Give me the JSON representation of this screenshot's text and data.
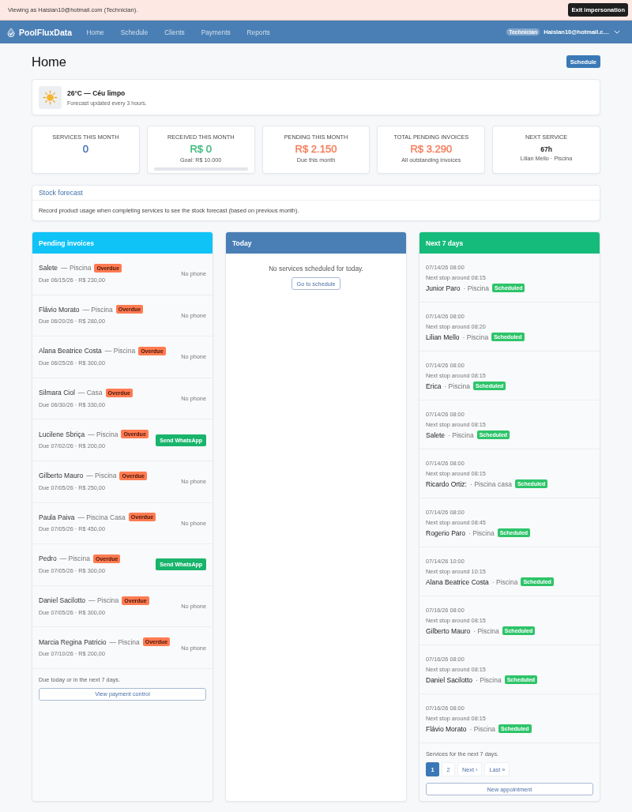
{
  "impersonation_banner": {
    "text": "Viewing as Haislan10@hotmail.com (Technician).",
    "button": "Exit impersonation"
  },
  "navbar": {
    "brand": "PoolFluxData",
    "items": [
      "Home",
      "Schedule",
      "Clients",
      "Payments",
      "Reports"
    ],
    "role_badge": "Technician",
    "user": "Haislan10@hotmail.c…"
  },
  "page": {
    "title": "Home",
    "button": "Schedule"
  },
  "weather": {
    "title": "26°C — Céu limpo",
    "note": "Forecast updated every 3 hours."
  },
  "stats": [
    {
      "kind": "count",
      "label": "SERVICES THIS MONTH",
      "value": "0",
      "color": "#3f6fb3"
    },
    {
      "kind": "progress",
      "label": "RECEIVED THIS MONTH",
      "value": "R$ 0",
      "color": "#3cb878",
      "note": "Goal: R$ 10.000",
      "level": 0
    },
    {
      "kind": "amount",
      "label": "PENDING THIS MONTH",
      "value": "R$ 2.150",
      "color": "#f47b59",
      "note": "Due this month"
    },
    {
      "kind": "amount",
      "label": "TOTAL PENDING INVOICES",
      "value": "R$ 3.290",
      "color": "#f47b59",
      "note": "All outstanding invoices"
    },
    {
      "kind": "next",
      "label": "NEXT SERVICE",
      "value": "67h",
      "color": "#222222",
      "note": "Lilian Mello · Piscina"
    }
  ],
  "stock_forecast": {
    "title": "Stock forecast",
    "text": "Record product usage when completing services to see the stock forecast (based on previous month)."
  },
  "pending_invoices": {
    "title": "Pending invoices",
    "rows": [
      {
        "name": "Salete",
        "place": "— Piscina",
        "badge": "Overdue",
        "due": "Due 06/15/26 · R$ 230,00",
        "kind": "note",
        "action": "No phone"
      },
      {
        "name": "Flávio Morato",
        "place": "— Piscina",
        "badge": "Overdue",
        "due": "Due 06/20/26 · R$ 280,00",
        "kind": "note",
        "action": "No phone"
      },
      {
        "name": "Alana Beatrice Costa",
        "place": "— Piscina",
        "badge": "Overdue",
        "due": "Due 06/25/26 · R$ 300,00",
        "kind": "note",
        "action": "No phone"
      },
      {
        "name": "Silmara Ciol",
        "place": "— Casa",
        "badge": "Overdue",
        "due": "Due 06/30/26 · R$ 330,00",
        "kind": "note",
        "action": "No phone"
      },
      {
        "name": "Lucilene Sbriça",
        "place": "— Piscina",
        "badge": "Overdue",
        "due": "Due 07/02/26 · R$ 200,00",
        "kind": "whatsapp",
        "action": "Send WhatsApp"
      },
      {
        "name": "Gilberto Mauro",
        "place": "— Piscina",
        "badge": "Overdue",
        "due": "Due 07/05/26 · R$ 250,00",
        "kind": "note",
        "action": "No phone"
      },
      {
        "name": "Paula Paiva",
        "place": "— Piscina Casa",
        "badge": "Overdue",
        "due": "Due 07/05/26 · R$ 450,00",
        "kind": "note",
        "action": "No phone"
      },
      {
        "name": "Pedro",
        "place": "— Piscina",
        "badge": "Overdue",
        "due": "Due 07/05/26 · R$ 300,00",
        "kind": "whatsapp",
        "action": "Send WhatsApp"
      },
      {
        "name": "Daniel Sacilotto",
        "place": "— Piscina",
        "badge": "Overdue",
        "due": "Due 07/05/26 · R$ 300,00",
        "kind": "note",
        "action": "No phone"
      },
      {
        "name": "Marcia Regina Patricio",
        "place": "— Piscina",
        "badge": "Overdue",
        "due": "Due 07/10/26 · R$ 200,00",
        "kind": "note",
        "action": "No phone"
      }
    ],
    "footer": "Due today or in the next 7 days.",
    "button": "View payment control"
  },
  "today": {
    "title": "Today",
    "empty": "No services scheduled for today.",
    "button": "Go to schedule"
  },
  "next_7_days": {
    "title": "Next 7 days",
    "rows": [
      {
        "date": "07/14/26 08:00",
        "eta": "Next stop around 08:15",
        "name": "Junior Paro",
        "place": "· Piscina",
        "badge": "Scheduled"
      },
      {
        "date": "07/14/26 08:00",
        "eta": "Next stop around 08:20",
        "name": "Lilian Mello",
        "place": "· Piscina",
        "badge": "Scheduled"
      },
      {
        "date": "07/14/26 08:00",
        "eta": "Next stop around 08:15",
        "name": "Erica",
        "place": "· Piscina",
        "badge": "Scheduled"
      },
      {
        "date": "07/14/26 08:00",
        "eta": "Next stop around 08:15",
        "name": "Salete",
        "place": "· Piscina",
        "badge": "Scheduled"
      },
      {
        "date": "07/14/26 08:00",
        "eta": "Next stop around 08:15",
        "name": "Ricardo Ortiz:",
        "place": "· Piscina casa",
        "badge": "Scheduled"
      },
      {
        "date": "07/14/26 08:00",
        "eta": "Next stop around 08:45",
        "name": "Rogerio Paro",
        "place": "· Piscina",
        "badge": "Scheduled"
      },
      {
        "date": "07/14/26 10:00",
        "eta": "Next stop around 10:15",
        "name": "Alana Beatrice Costa",
        "place": "· Piscina",
        "badge": "Scheduled"
      },
      {
        "date": "07/16/26 08:00",
        "eta": "Next stop around 08:15",
        "name": "Gilberto Mauro",
        "place": "· Piscina",
        "badge": "Scheduled"
      },
      {
        "date": "07/16/26 08:00",
        "eta": "Next stop around 08:15",
        "name": "Daniel Sacilotto",
        "place": "· Piscina",
        "badge": "Scheduled"
      },
      {
        "date": "07/16/26 08:00",
        "eta": "Next stop around 08:15",
        "name": "Flávio Morato",
        "place": "· Piscina",
        "badge": "Scheduled"
      }
    ],
    "footer": "Services for the next 7 days.",
    "pagination": [
      {
        "label": "1",
        "selected": true
      },
      {
        "label": "2",
        "selected": false
      },
      {
        "label": "Next ›",
        "selected": false
      },
      {
        "label": "Last »",
        "selected": false
      }
    ],
    "button": "New appointment"
  }
}
